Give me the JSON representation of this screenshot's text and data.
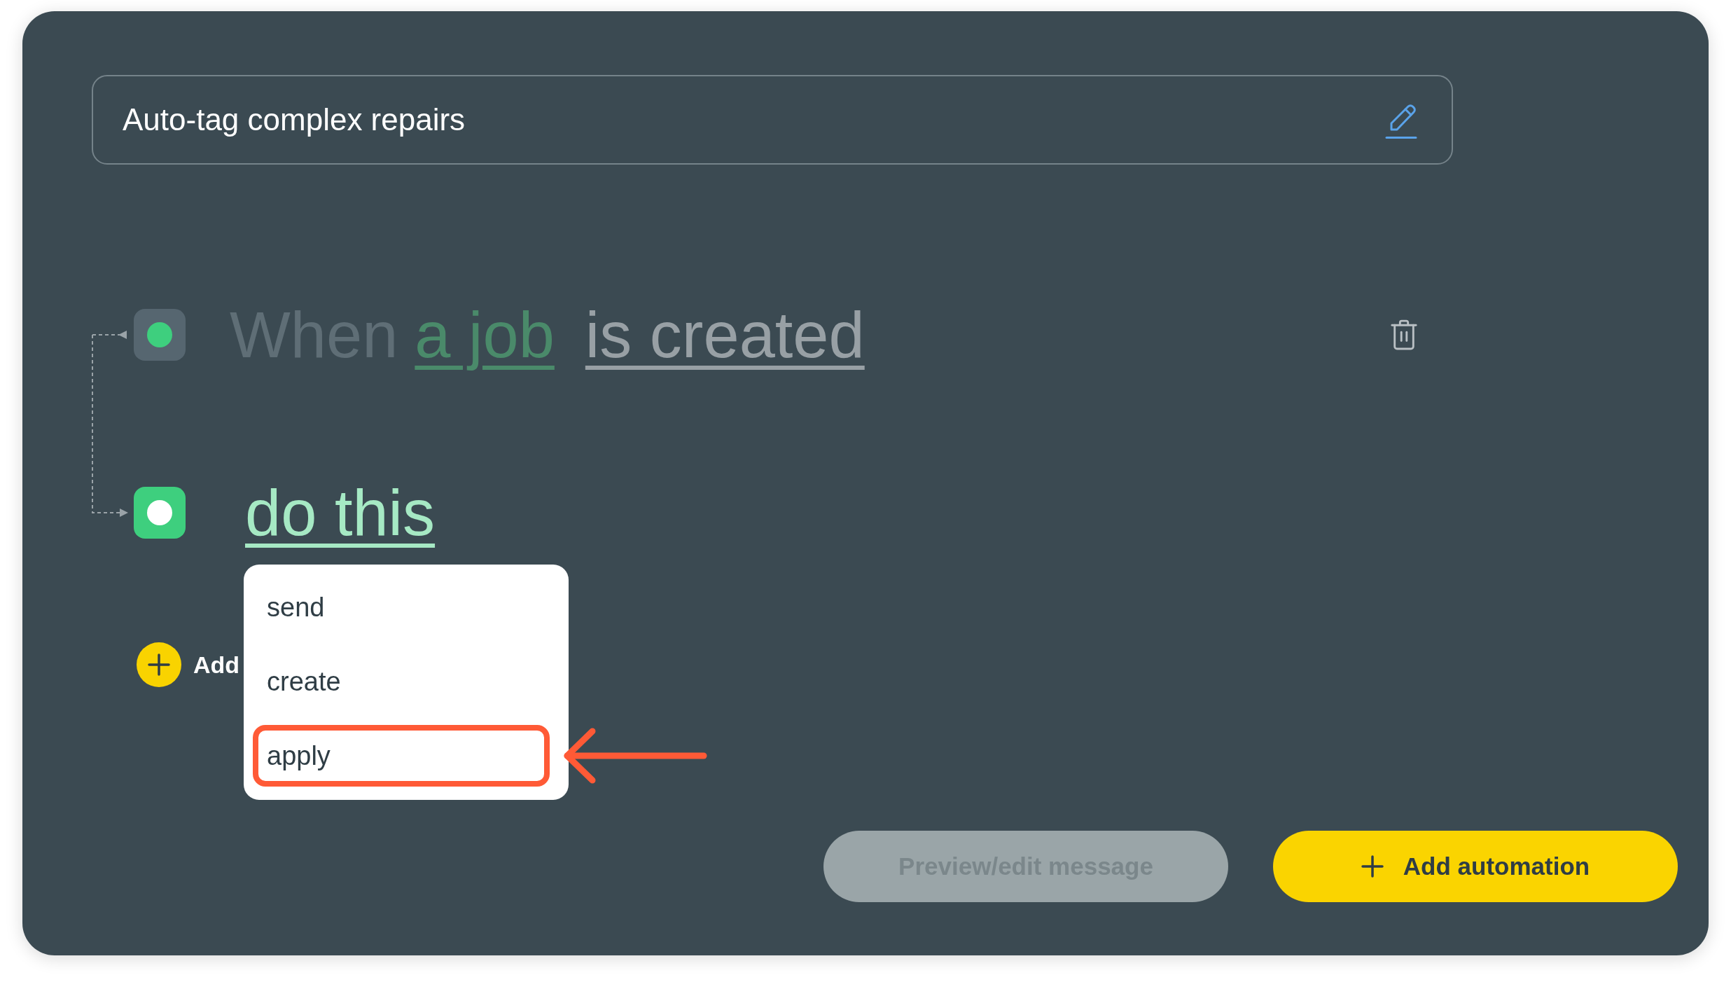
{
  "automation_name": {
    "value": "Auto-tag complex repairs"
  },
  "trigger": {
    "active": false,
    "prefix": "When",
    "subject": "a job",
    "event": "is created"
  },
  "action": {
    "active": true,
    "label": "do this"
  },
  "add_step": {
    "label": "Add"
  },
  "action_menu": {
    "items": [
      {
        "label": "send",
        "highlighted": false
      },
      {
        "label": "create",
        "highlighted": false
      },
      {
        "label": "apply",
        "highlighted": true
      }
    ]
  },
  "buttons": [
    {
      "kind": "secondary",
      "label": "Preview/edit message",
      "disabled": true
    },
    {
      "kind": "primary",
      "label": "Add automation",
      "disabled": false
    }
  ]
}
